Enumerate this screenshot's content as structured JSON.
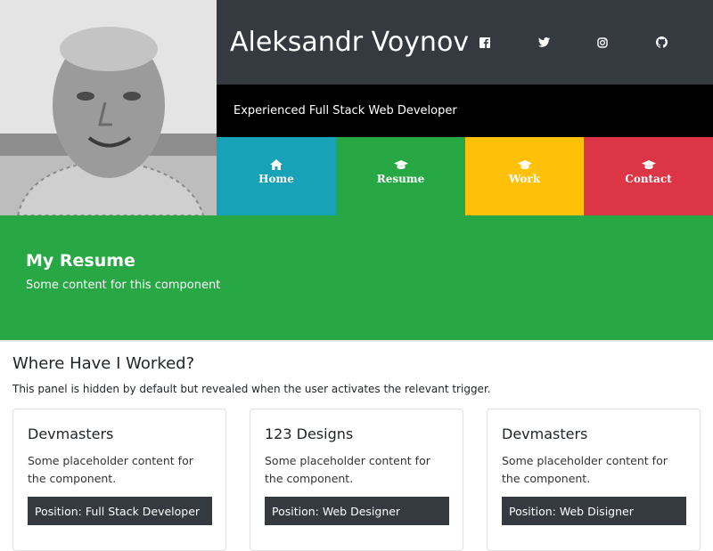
{
  "header": {
    "name": "Aleksandr Voynov",
    "tagline": "Experienced Full Stack Web Developer",
    "social": [
      "facebook-icon",
      "twitter-icon",
      "instagram-icon",
      "github-icon"
    ]
  },
  "nav": {
    "tabs": [
      {
        "label": "Home",
        "icon": "home-icon",
        "color": "#17a2b8"
      },
      {
        "label": "Resume",
        "icon": "graduation-cap-icon",
        "color": "#28a745"
      },
      {
        "label": "Work",
        "icon": "graduation-cap-icon",
        "color": "#ffc107"
      },
      {
        "label": "Contact",
        "icon": "graduation-cap-icon",
        "color": "#dc3545"
      }
    ]
  },
  "hero": {
    "title": "My Resume",
    "text": "Some content for this component",
    "color": "#28a745"
  },
  "work": {
    "title": "Where Have I Worked?",
    "subtitle": "This panel is hidden by default but revealed when the user activates the relevant trigger.",
    "cards": [
      {
        "title": "Devmasters",
        "body": "Some placeholder content for the component.",
        "position": "Position: Full Stack Developer"
      },
      {
        "title": "123 Designs",
        "body": "Some placeholder content for the component.",
        "position": "Position: Web Designer"
      },
      {
        "title": "Devmasters",
        "body": "Some placeholder content for the component.",
        "position": "Position: Web Disigner"
      }
    ]
  },
  "colors": {
    "dark": "#343a40",
    "black": "#000000"
  }
}
